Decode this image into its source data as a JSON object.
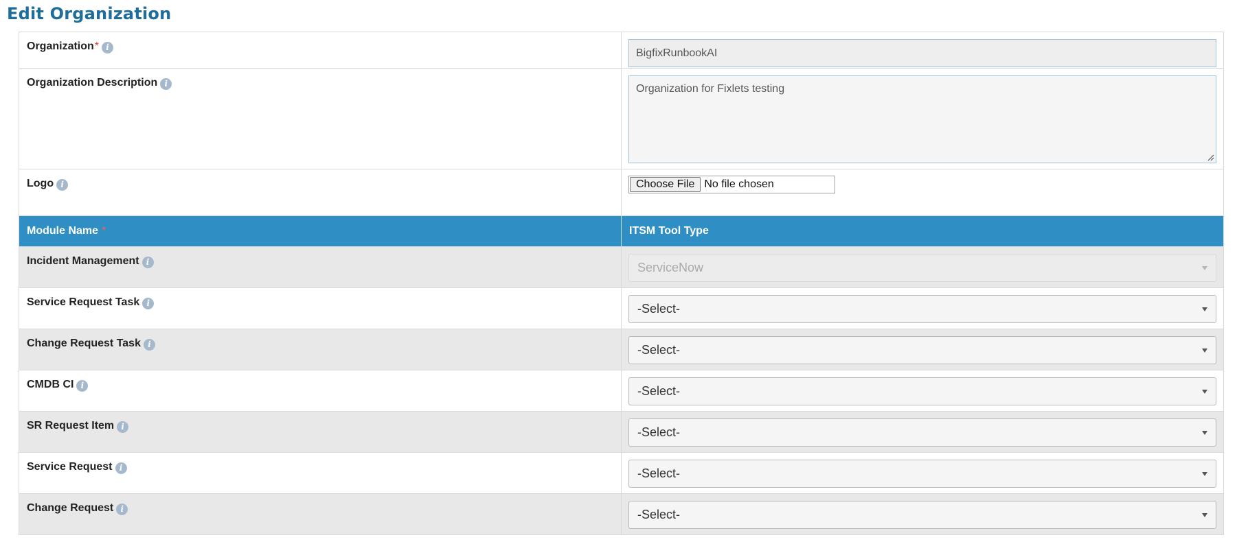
{
  "page": {
    "title": "Edit Organization"
  },
  "organization": {
    "label": "Organization",
    "required_mark": "*",
    "value": "BigfixRunbookAI"
  },
  "description": {
    "label": "Organization Description",
    "value": "Organization for Fixlets testing"
  },
  "logo": {
    "label": "Logo",
    "button_label": "Choose File",
    "status": "No file chosen"
  },
  "modules_header": {
    "module_name": "Module Name",
    "required_mark": "*",
    "itsm_tool_type": "ITSM Tool Type"
  },
  "modules": [
    {
      "name": "Incident Management",
      "selected": "ServiceNow",
      "disabled": true
    },
    {
      "name": "Service Request Task",
      "selected": "-Select-",
      "disabled": false
    },
    {
      "name": "Change Request Task",
      "selected": "-Select-",
      "disabled": false
    },
    {
      "name": "CMDB CI",
      "selected": "-Select-",
      "disabled": false
    },
    {
      "name": "SR Request Item",
      "selected": "-Select-",
      "disabled": false
    },
    {
      "name": "Service Request",
      "selected": "-Select-",
      "disabled": false
    },
    {
      "name": "Change Request",
      "selected": "-Select-",
      "disabled": false
    }
  ],
  "icons": {
    "info": "info-icon",
    "dropdown": "chevron-down-icon"
  },
  "colors": {
    "title": "#1f6d99",
    "header_bg": "#2f8fc4",
    "required": "#e03b3b",
    "info_icon": "#a6b9cc",
    "row_shade": "#e8e8e8"
  }
}
